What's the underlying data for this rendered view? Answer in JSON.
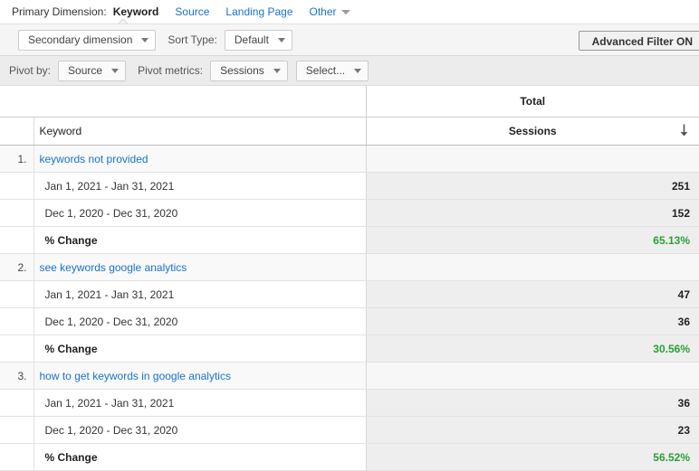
{
  "primary_dimension": {
    "label": "Primary Dimension:",
    "tabs": [
      {
        "label": "Keyword",
        "active": true
      },
      {
        "label": "Source",
        "active": false
      },
      {
        "label": "Landing Page",
        "active": false
      },
      {
        "label": "Other",
        "active": false,
        "has_dropdown": true
      }
    ]
  },
  "toolbar_secondary": {
    "secondary_dimension_label": "Secondary dimension",
    "sort_type_label": "Sort Type:",
    "sort_type_value": "Default",
    "advanced_filter_label": "Advanced Filter ON"
  },
  "toolbar_pivot": {
    "pivot_by_label": "Pivot by:",
    "pivot_by_value": "Source",
    "pivot_metrics_label": "Pivot metrics:",
    "pivot_metric_1": "Sessions",
    "pivot_metric_2": "Select..."
  },
  "table": {
    "group_header": "Total",
    "dimension_header": "Keyword",
    "metric_header": "Sessions",
    "sort_icon": "arrow-down-icon",
    "rows": [
      {
        "index": "1.",
        "keyword": "keywords not provided",
        "keyword_value": "",
        "periods": [
          {
            "label": "Jan 1, 2021 - Jan 31, 2021",
            "value": "251"
          },
          {
            "label": "Dec 1, 2020 - Dec 31, 2020",
            "value": "152"
          }
        ],
        "change_label": "% Change",
        "change_value": "65.13%"
      },
      {
        "index": "2.",
        "keyword": "see keywords google analytics",
        "keyword_value": "",
        "periods": [
          {
            "label": "Jan 1, 2021 - Jan 31, 2021",
            "value": "47"
          },
          {
            "label": "Dec 1, 2020 - Dec 31, 2020",
            "value": "36"
          }
        ],
        "change_label": "% Change",
        "change_value": "30.56%"
      },
      {
        "index": "3.",
        "keyword": "how to get keywords in google analytics",
        "keyword_value": "",
        "periods": [
          {
            "label": "Jan 1, 2021 - Jan 31, 2021",
            "value": "36"
          },
          {
            "label": "Dec 1, 2020 - Dec 31, 2020",
            "value": "23"
          }
        ],
        "change_label": "% Change",
        "change_value": "56.52%"
      }
    ]
  },
  "colors": {
    "link": "#1a73c8",
    "positive_change": "#2aa038",
    "toolbar_bg": "#f5f5f5",
    "pivot_bg": "#ececec"
  }
}
